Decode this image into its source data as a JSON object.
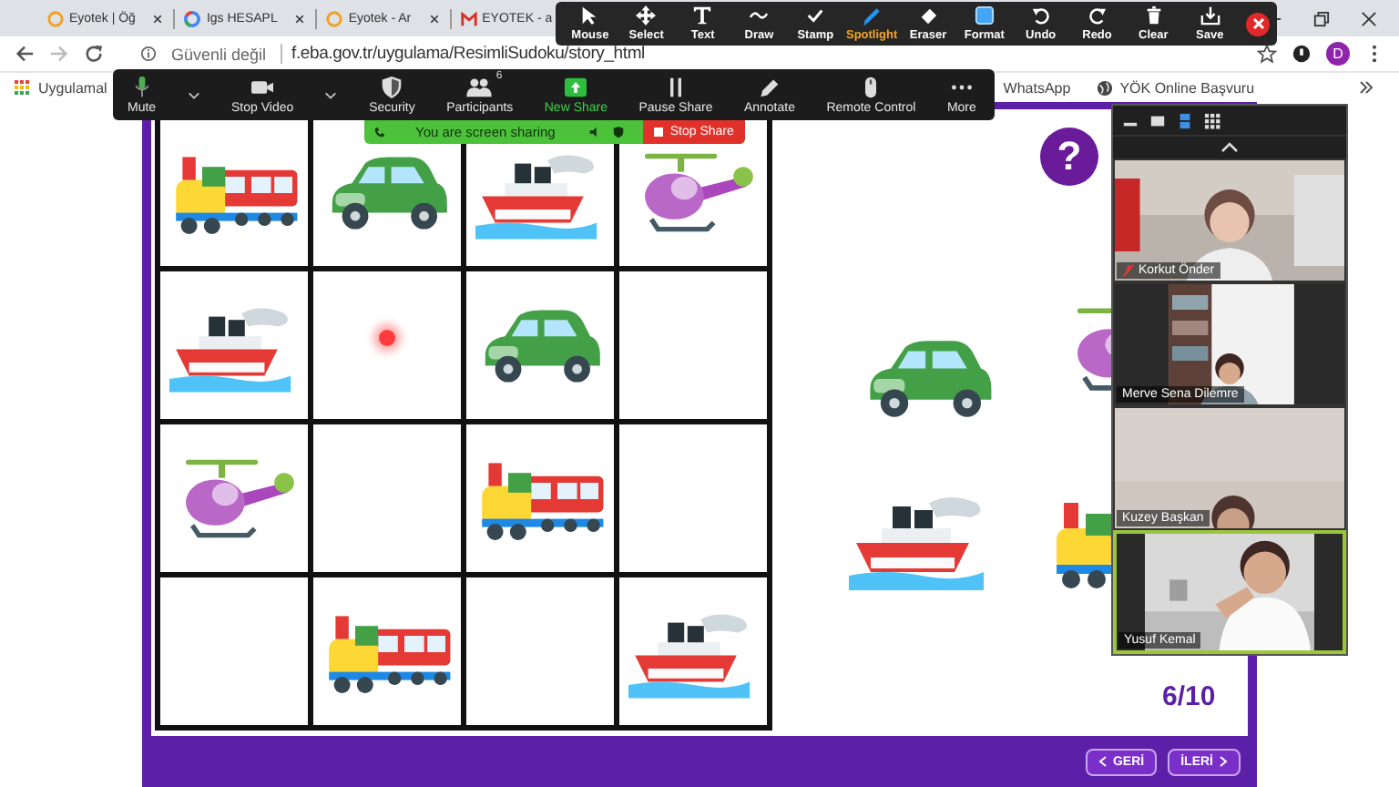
{
  "browser": {
    "tabs": [
      {
        "label": "Eyotek | Öğ",
        "kind": "ring"
      },
      {
        "label": "Igs HESAPL",
        "kind": "circle"
      },
      {
        "label": "Eyotek - Ar",
        "kind": "ring"
      },
      {
        "label": "EYOTEK - a",
        "kind": "mail"
      }
    ],
    "security_label": "Güvenli değil",
    "url": "f.eba.gov.tr/uygulama/ResimliSudoku/story_html",
    "profile": "D",
    "bookmarks": [
      {
        "label": "Uygulamal",
        "kind": "apps"
      },
      {
        "label": "WhatsApp",
        "kind": "plain"
      },
      {
        "label": "YÖK Online Başvuru",
        "kind": "globe"
      }
    ]
  },
  "annotation_toolbar": [
    {
      "label": "Mouse",
      "selected": false
    },
    {
      "label": "Select",
      "selected": false
    },
    {
      "label": "Text",
      "selected": false
    },
    {
      "label": "Draw",
      "selected": false
    },
    {
      "label": "Stamp",
      "selected": false
    },
    {
      "label": "Spotlight",
      "selected": true
    },
    {
      "label": "Eraser",
      "selected": false
    },
    {
      "label": "Format",
      "selected": false
    },
    {
      "label": "Undo",
      "selected": false
    },
    {
      "label": "Redo",
      "selected": false
    },
    {
      "label": "Clear",
      "selected": false
    },
    {
      "label": "Save",
      "selected": false
    }
  ],
  "meeting_toolbar": [
    {
      "label": "Mute",
      "has_menu": true
    },
    {
      "label": "Stop Video",
      "has_menu": true
    },
    {
      "label": "Security",
      "has_menu": false
    },
    {
      "label": "Participants",
      "has_menu": false,
      "count": "6"
    },
    {
      "label": "New Share",
      "has_menu": false
    },
    {
      "label": "Pause Share",
      "has_menu": false
    },
    {
      "label": "Annotate",
      "has_menu": false
    },
    {
      "label": "Remote Control",
      "has_menu": false
    },
    {
      "label": "More",
      "has_menu": false
    }
  ],
  "sharing_banner": {
    "message": "You are screen sharing",
    "stop_label": "Stop Share"
  },
  "sudoku": {
    "cells": [
      {
        "kind": "train",
        "pointer": false
      },
      {
        "kind": "car",
        "pointer": false
      },
      {
        "kind": "ship",
        "pointer": false
      },
      {
        "kind": "helicopter",
        "pointer": false
      },
      {
        "kind": "ship",
        "pointer": false
      },
      {
        "kind": "empty",
        "pointer": true
      },
      {
        "kind": "car",
        "pointer": false
      },
      {
        "kind": "empty",
        "pointer": false
      },
      {
        "kind": "helicopter",
        "pointer": false
      },
      {
        "kind": "empty",
        "pointer": false
      },
      {
        "kind": "train",
        "pointer": false
      },
      {
        "kind": "empty",
        "pointer": false
      },
      {
        "kind": "empty",
        "pointer": false
      },
      {
        "kind": "train",
        "pointer": false
      },
      {
        "kind": "empty",
        "pointer": false
      },
      {
        "kind": "ship",
        "pointer": false
      }
    ],
    "pieces": [
      {
        "kind": "car"
      },
      {
        "kind": "helicopter"
      },
      {
        "kind": "ship"
      },
      {
        "kind": "train"
      }
    ],
    "help": "?",
    "progress": "6/10",
    "back_label": "GERİ",
    "next_label": "İLERİ"
  },
  "video_panel": {
    "participants": [
      {
        "name": "Korkut Önder",
        "muted": true,
        "active": false
      },
      {
        "name": "Merve Sena Dilemre",
        "muted": false,
        "active": false
      },
      {
        "name": "Kuzey Başkan",
        "muted": false,
        "active": false
      },
      {
        "name": "Yusuf Kemal",
        "muted": false,
        "active": true
      }
    ]
  }
}
